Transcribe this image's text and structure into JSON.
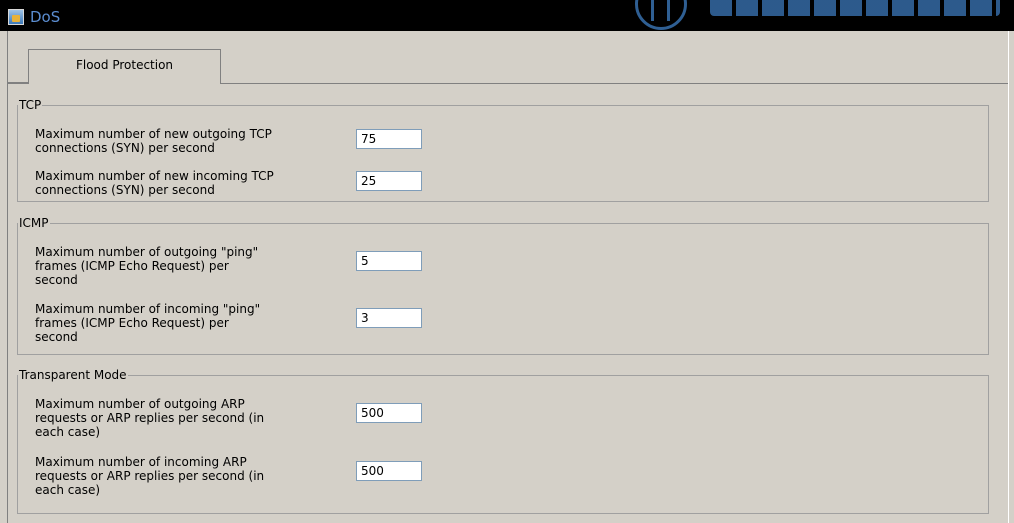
{
  "window": {
    "title": "DoS",
    "icon": "window-app-icon",
    "logo": "brand-logo"
  },
  "tabs": [
    {
      "label": "Flood Protection"
    }
  ],
  "groups": {
    "tcp": {
      "legend": "TCP",
      "fields": [
        {
          "label": "Maximum number of new outgoing TCP\nconnections (SYN) per second",
          "value": "75"
        },
        {
          "label": "Maximum number of new incoming TCP\nconnections (SYN) per second",
          "value": "25"
        }
      ]
    },
    "icmp": {
      "legend": "ICMP",
      "fields": [
        {
          "label": "Maximum number of outgoing \"ping\"\nframes (ICMP Echo Request) per\nsecond",
          "value": "5"
        },
        {
          "label": "Maximum number of incoming \"ping\"\nframes (ICMP Echo Request) per\nsecond",
          "value": "3"
        }
      ]
    },
    "transparent": {
      "legend": "Transparent Mode",
      "fields": [
        {
          "label": "Maximum number of outgoing ARP\nrequests or ARP replies per second (in\neach case)",
          "value": "500"
        },
        {
          "label": "Maximum number of incoming ARP\nrequests or ARP replies per second (in\neach case)",
          "value": "500"
        }
      ]
    }
  },
  "colors": {
    "background": "#d4d0c8",
    "titlebar": "#000000",
    "title_text": "#5b8dd0",
    "input_border": "#7f9db9"
  }
}
